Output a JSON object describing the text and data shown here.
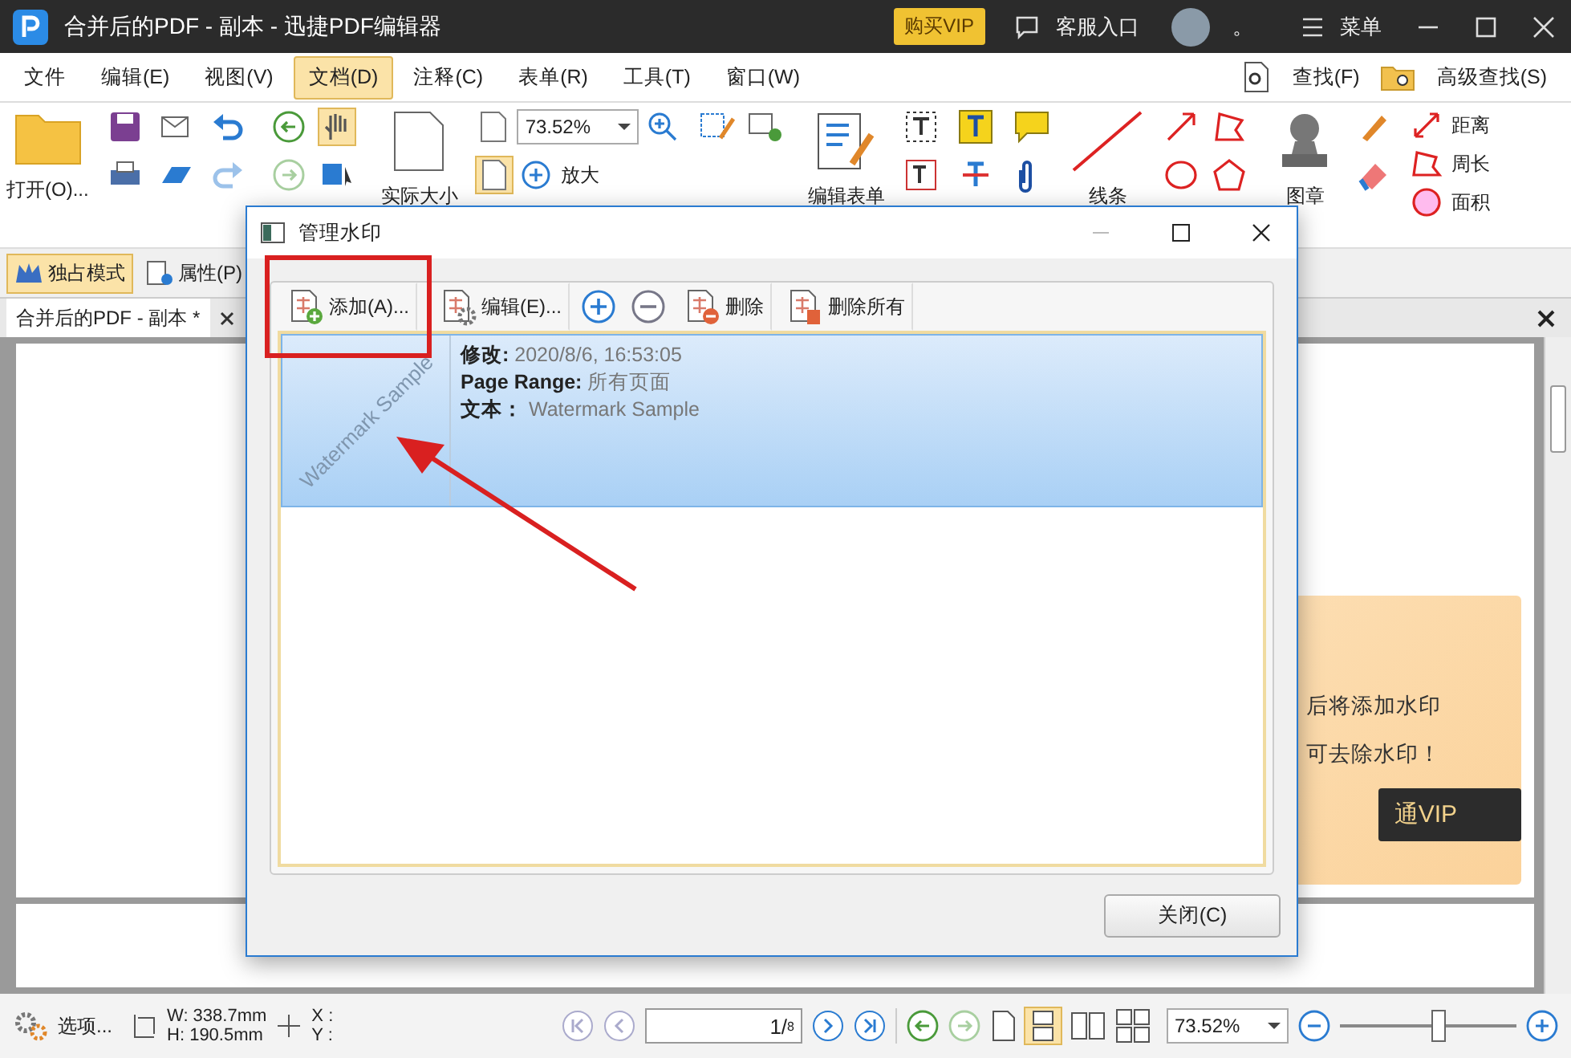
{
  "window": {
    "title": "合并后的PDF - 副本 - 迅捷PDF编辑器",
    "vip_button": "购买VIP",
    "support": "客服入口",
    "dot": "。",
    "menu": "菜单"
  },
  "menu_bar": {
    "items": [
      {
        "label": "文件",
        "selected": false
      },
      {
        "label": "编辑(E)",
        "selected": false
      },
      {
        "label": "视图(V)",
        "selected": false
      },
      {
        "label": "文档(D)",
        "selected": true
      },
      {
        "label": "注释(C)",
        "selected": false
      },
      {
        "label": "表单(R)",
        "selected": false
      },
      {
        "label": "工具(T)",
        "selected": false
      },
      {
        "label": "窗口(W)",
        "selected": false
      }
    ],
    "find": "查找(F)",
    "advanced_find": "高级查找(S)"
  },
  "ribbon": {
    "open": "打开(O)...",
    "zoom_value": "73.52%",
    "zoom_in": "放大",
    "actual_size": "实际大小",
    "edit_form": "编辑表单",
    "line": "线条",
    "stamp": "图章",
    "distance": "距离",
    "perimeter": "周长",
    "area": "面积"
  },
  "mode_bar": {
    "buttons": [
      {
        "label": "独占模式",
        "selected": true
      },
      {
        "label": "属性(P)",
        "selected": false
      }
    ]
  },
  "document_tabs": [
    {
      "label": "合并后的PDF - 副本 *",
      "selected": true
    }
  ],
  "vip_panel": {
    "lines": [
      "后将添加水印",
      "可去除水印！"
    ],
    "button": "通VIP"
  },
  "status_bar": {
    "options": "选项...",
    "width": "W: 338.7mm",
    "height": "H: 190.5mm",
    "x": "X :",
    "y": "Y :",
    "page": "1",
    "page_separator": "/",
    "page_total": "8",
    "zoom": "73.52%",
    "level": 0.55
  },
  "dialog": {
    "title": "管理水印",
    "toolbar": [
      {
        "kind": "add",
        "label": "添加(A)...",
        "highlighted": true
      },
      {
        "kind": "edit",
        "label": "编辑(E)...",
        "highlighted": false
      },
      {
        "kind": "plus",
        "highlighted": false
      },
      {
        "kind": "minus",
        "highlighted": false
      },
      {
        "kind": "delete",
        "label": "删除",
        "highlighted": false
      },
      {
        "kind": "delete-all",
        "label": "删除所有",
        "highlighted": false
      }
    ],
    "watermarks": [
      {
        "thumbnail_text": "Watermark Sample",
        "modified_label": "修改:",
        "modified": "2020/8/6, 16:53:05",
        "range_label": "Page Range:",
        "range": "所有页面",
        "text_label": "文本：",
        "text": "Watermark Sample",
        "selected": true
      }
    ],
    "close_button": "关闭(C)"
  }
}
